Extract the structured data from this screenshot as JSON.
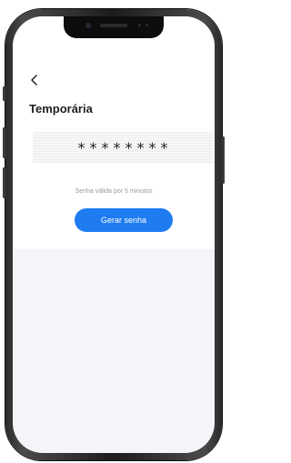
{
  "header": {
    "back_icon": "chevron-left-icon",
    "title": "Temporária"
  },
  "password": {
    "masked_value": "********"
  },
  "validity_text": "Senha válida por 5 minutos",
  "generate_button": {
    "label": "Gerar senha"
  },
  "colors": {
    "accent": "#1e7cf0",
    "background": "#f4f5f8",
    "card": "#ffffff"
  }
}
